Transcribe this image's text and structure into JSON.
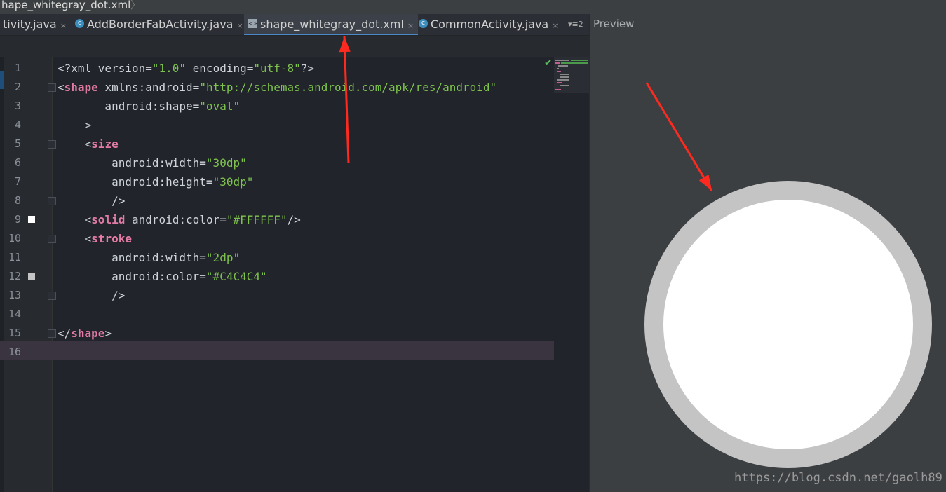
{
  "breadcrumb": {
    "file": "hape_whitegray_dot.xml"
  },
  "tabs": [
    {
      "label": "tivity.java",
      "icon": "none",
      "active": false
    },
    {
      "label": "AddBorderFabActivity.java",
      "icon": "class-icon",
      "active": false
    },
    {
      "label": "shape_whitegray_dot.xml",
      "icon": "xml-file-icon",
      "active": true
    },
    {
      "label": "CommonActivity.java",
      "icon": "class-icon",
      "active": false
    }
  ],
  "tab_close_glyph": "×",
  "tab_overflow": "▾≡2",
  "preview": {
    "label": "Preview",
    "fill_color": "#FFFFFF",
    "stroke_color": "#C4C4C4"
  },
  "line_numbers": [
    "1",
    "2",
    "3",
    "4",
    "5",
    "6",
    "7",
    "8",
    "9",
    "10",
    "11",
    "12",
    "13",
    "14",
    "15",
    "16"
  ],
  "code_lines": [
    [
      [
        "punc",
        "<?xml version="
      ],
      [
        "str",
        "\"1.0\""
      ],
      [
        "punc",
        " encoding="
      ],
      [
        "str",
        "\"utf-8\""
      ],
      [
        "punc",
        "?>"
      ]
    ],
    [
      [
        "punc",
        "<"
      ],
      [
        "tag",
        "shape"
      ],
      [
        "attr",
        " xmlns:android="
      ],
      [
        "str",
        "\"http://schemas.android.com/apk/res/android\""
      ]
    ],
    [
      [
        "attr",
        "       android:shape="
      ],
      [
        "str",
        "\"oval\""
      ]
    ],
    [
      [
        "punc",
        "    >"
      ]
    ],
    [
      [
        "punc",
        "    <"
      ],
      [
        "tag",
        "size"
      ]
    ],
    [
      [
        "attr",
        "        android:width="
      ],
      [
        "str",
        "\"30dp\""
      ]
    ],
    [
      [
        "attr",
        "        android:height="
      ],
      [
        "str",
        "\"30dp\""
      ]
    ],
    [
      [
        "punc",
        "        />"
      ]
    ],
    [
      [
        "punc",
        "    <"
      ],
      [
        "tag",
        "solid"
      ],
      [
        "attr",
        " android:color="
      ],
      [
        "str",
        "\"#FFFFFF\""
      ],
      [
        "punc",
        "/>"
      ]
    ],
    [
      [
        "punc",
        "    <"
      ],
      [
        "tag",
        "stroke"
      ]
    ],
    [
      [
        "attr",
        "        android:width="
      ],
      [
        "str",
        "\"2dp\""
      ]
    ],
    [
      [
        "attr",
        "        android:color="
      ],
      [
        "str",
        "\"#C4C4C4\""
      ]
    ],
    [
      [
        "punc",
        "        />"
      ]
    ],
    [
      [
        "punc",
        ""
      ]
    ],
    [
      [
        "punc",
        "</"
      ],
      [
        "tag",
        "shape"
      ],
      [
        "punc",
        ">"
      ]
    ],
    [
      [
        "punc",
        ""
      ]
    ]
  ],
  "gutter_swatches": {
    "9": "#FFFFFF",
    "12": "#C4C4C4"
  },
  "watermark": "https://blog.csdn.net/gaolh89",
  "annotation_color": "#FF2A1F"
}
